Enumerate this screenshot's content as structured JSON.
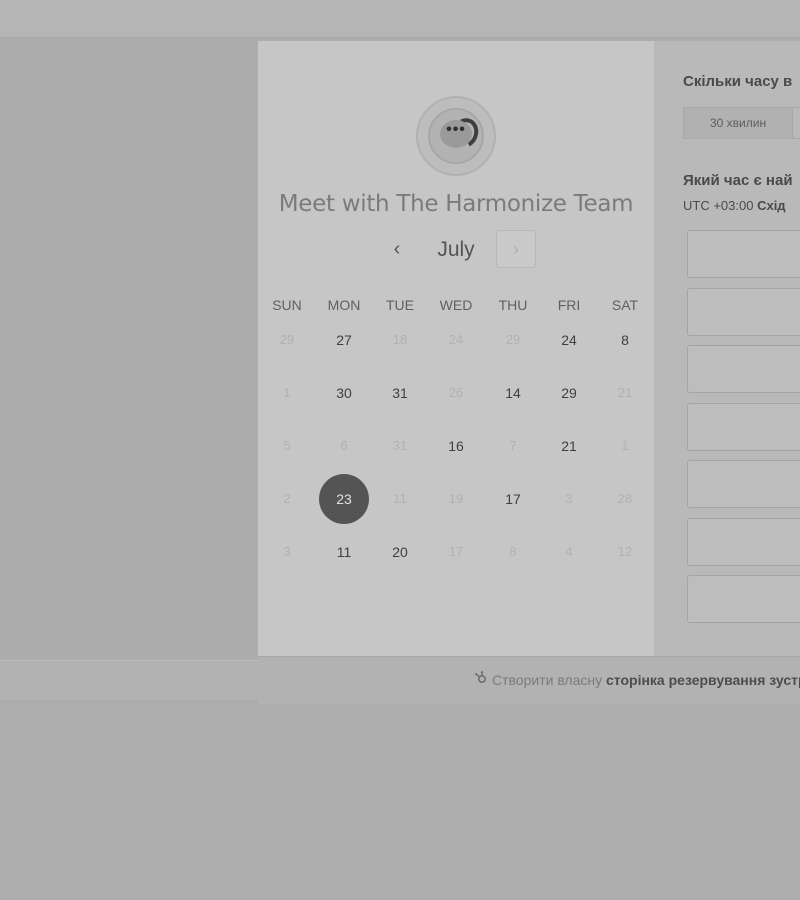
{
  "colors": {
    "selected_day": "#545454",
    "page_bg": "#adadad",
    "card_bg": "#c6c6c6"
  },
  "meeting": {
    "title": "Meet with The Harmonize Team",
    "avatar_icon": "chat-bubble-q-logo",
    "avatar_dots": "•••"
  },
  "calendar": {
    "month": "July",
    "prev_icon": "‹",
    "next_icon": "›",
    "weekdays": [
      "SUN",
      "MON",
      "TUE",
      "WED",
      "THU",
      "FRI",
      "SAT"
    ],
    "weeks": [
      [
        {
          "d": "29",
          "s": "dis"
        },
        {
          "d": "27",
          "s": "avail"
        },
        {
          "d": "18",
          "s": "dis"
        },
        {
          "d": "24",
          "s": "dis"
        },
        {
          "d": "29",
          "s": "dis"
        },
        {
          "d": "24",
          "s": "avail"
        },
        {
          "d": "8",
          "s": "avail"
        }
      ],
      [
        {
          "d": "1",
          "s": "dis"
        },
        {
          "d": "30",
          "s": "avail"
        },
        {
          "d": "31",
          "s": "avail"
        },
        {
          "d": "26",
          "s": "dis"
        },
        {
          "d": "14",
          "s": "avail"
        },
        {
          "d": "29",
          "s": "avail"
        },
        {
          "d": "21",
          "s": "dis"
        }
      ],
      [
        {
          "d": "5",
          "s": "dis"
        },
        {
          "d": "6",
          "s": "dis"
        },
        {
          "d": "31",
          "s": "dis"
        },
        {
          "d": "16",
          "s": "avail"
        },
        {
          "d": "7",
          "s": "dis"
        },
        {
          "d": "21",
          "s": "avail"
        },
        {
          "d": "1",
          "s": "dis"
        }
      ],
      [
        {
          "d": "2",
          "s": "dis"
        },
        {
          "d": "23",
          "s": "sel"
        },
        {
          "d": "11",
          "s": "dis"
        },
        {
          "d": "19",
          "s": "dis"
        },
        {
          "d": "17",
          "s": "avail"
        },
        {
          "d": "3",
          "s": "dis"
        },
        {
          "d": "28",
          "s": "dis"
        }
      ],
      [
        {
          "d": "3",
          "s": "dis"
        },
        {
          "d": "11",
          "s": "avail"
        },
        {
          "d": "20",
          "s": "avail"
        },
        {
          "d": "17",
          "s": "dis"
        },
        {
          "d": "8",
          "s": "dis"
        },
        {
          "d": "4",
          "s": "dis"
        },
        {
          "d": "12",
          "s": "dis"
        }
      ]
    ]
  },
  "booking": {
    "duration_question": "Скільки часу в",
    "duration_option": "30 хвилин",
    "time_question": "Який час є най",
    "timezone_offset": "UTC +03:00",
    "timezone_name": "Схід",
    "slot_count": 7
  },
  "footer": {
    "icon": "sprocket-icon",
    "prefix": "Створити власну",
    "link": "сторінка резервування зустр"
  }
}
